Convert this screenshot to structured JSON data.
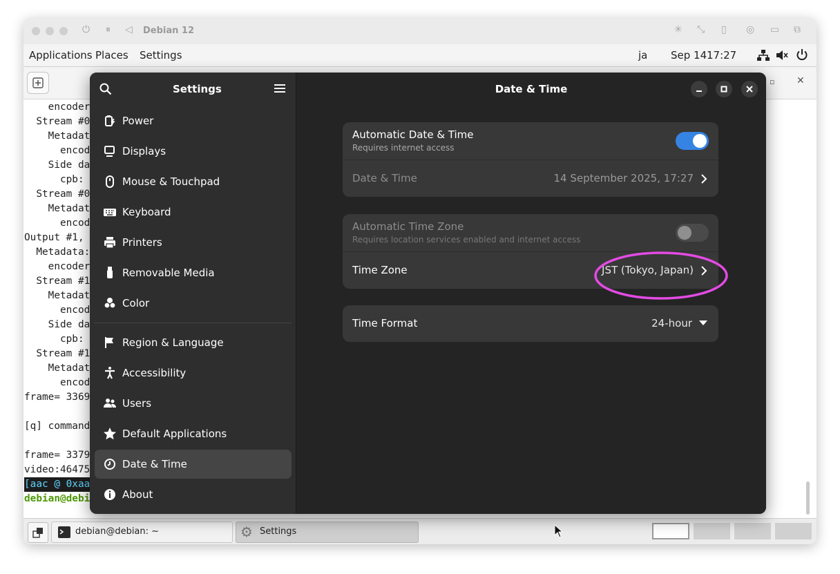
{
  "vm": {
    "title": "Debian 12"
  },
  "topbar": {
    "applications": "Applications",
    "places": "Places",
    "settings": "Settings",
    "ime": "ja",
    "date": "Sep 14",
    "time": "17:27"
  },
  "terminal": {
    "lines": [
      "    encoder",
      "  Stream #0",
      "    Metadat",
      "      encod",
      "    Side da",
      "      cpb:",
      "  Stream #0",
      "    Metadat",
      "      encod",
      "Output #1,",
      "  Metadata:",
      "    encoder",
      "  Stream #1",
      "    Metadat",
      "      encod",
      "    Side da",
      "      cpb:",
      "  Stream #1",
      "    Metadat",
      "      encod",
      "frame= 3369",
      "",
      "[q] command",
      "",
      "frame= 3379",
      "video:46475",
      "[aac @ 0xaa",
      "debian@debi"
    ]
  },
  "taskbar": {
    "terminal_label": "debian@debian: ~",
    "settings_label": "Settings"
  },
  "settings": {
    "sidebar_title": "Settings",
    "items": [
      {
        "label": "Power",
        "icon": "power-icon"
      },
      {
        "label": "Displays",
        "icon": "display-icon"
      },
      {
        "label": "Mouse & Touchpad",
        "icon": "mouse-icon"
      },
      {
        "label": "Keyboard",
        "icon": "keyboard-icon"
      },
      {
        "label": "Printers",
        "icon": "printer-icon"
      },
      {
        "label": "Removable Media",
        "icon": "usb-icon"
      },
      {
        "label": "Color",
        "icon": "color-icon"
      },
      {
        "label": "Region & Language",
        "icon": "flag-icon"
      },
      {
        "label": "Accessibility",
        "icon": "accessibility-icon"
      },
      {
        "label": "Users",
        "icon": "users-icon"
      },
      {
        "label": "Default Applications",
        "icon": "star-icon"
      },
      {
        "label": "Date & Time",
        "icon": "clock-icon"
      },
      {
        "label": "About",
        "icon": "info-icon"
      }
    ],
    "page_title": "Date & Time",
    "auto_datetime": {
      "title": "Automatic Date & Time",
      "subtitle": "Requires internet access",
      "enabled": true
    },
    "datetime": {
      "title": "Date & Time",
      "value": "14 September 2025, 17:27"
    },
    "auto_timezone": {
      "title": "Automatic Time Zone",
      "subtitle": "Requires location services enabled and internet access",
      "enabled": false
    },
    "timezone": {
      "title": "Time Zone",
      "value": "JST (Tokyo, Japan)"
    },
    "time_format": {
      "title": "Time Format",
      "value": "24-hour"
    }
  },
  "colors": {
    "accent": "#3584e4",
    "highlight": "#e34be3"
  }
}
